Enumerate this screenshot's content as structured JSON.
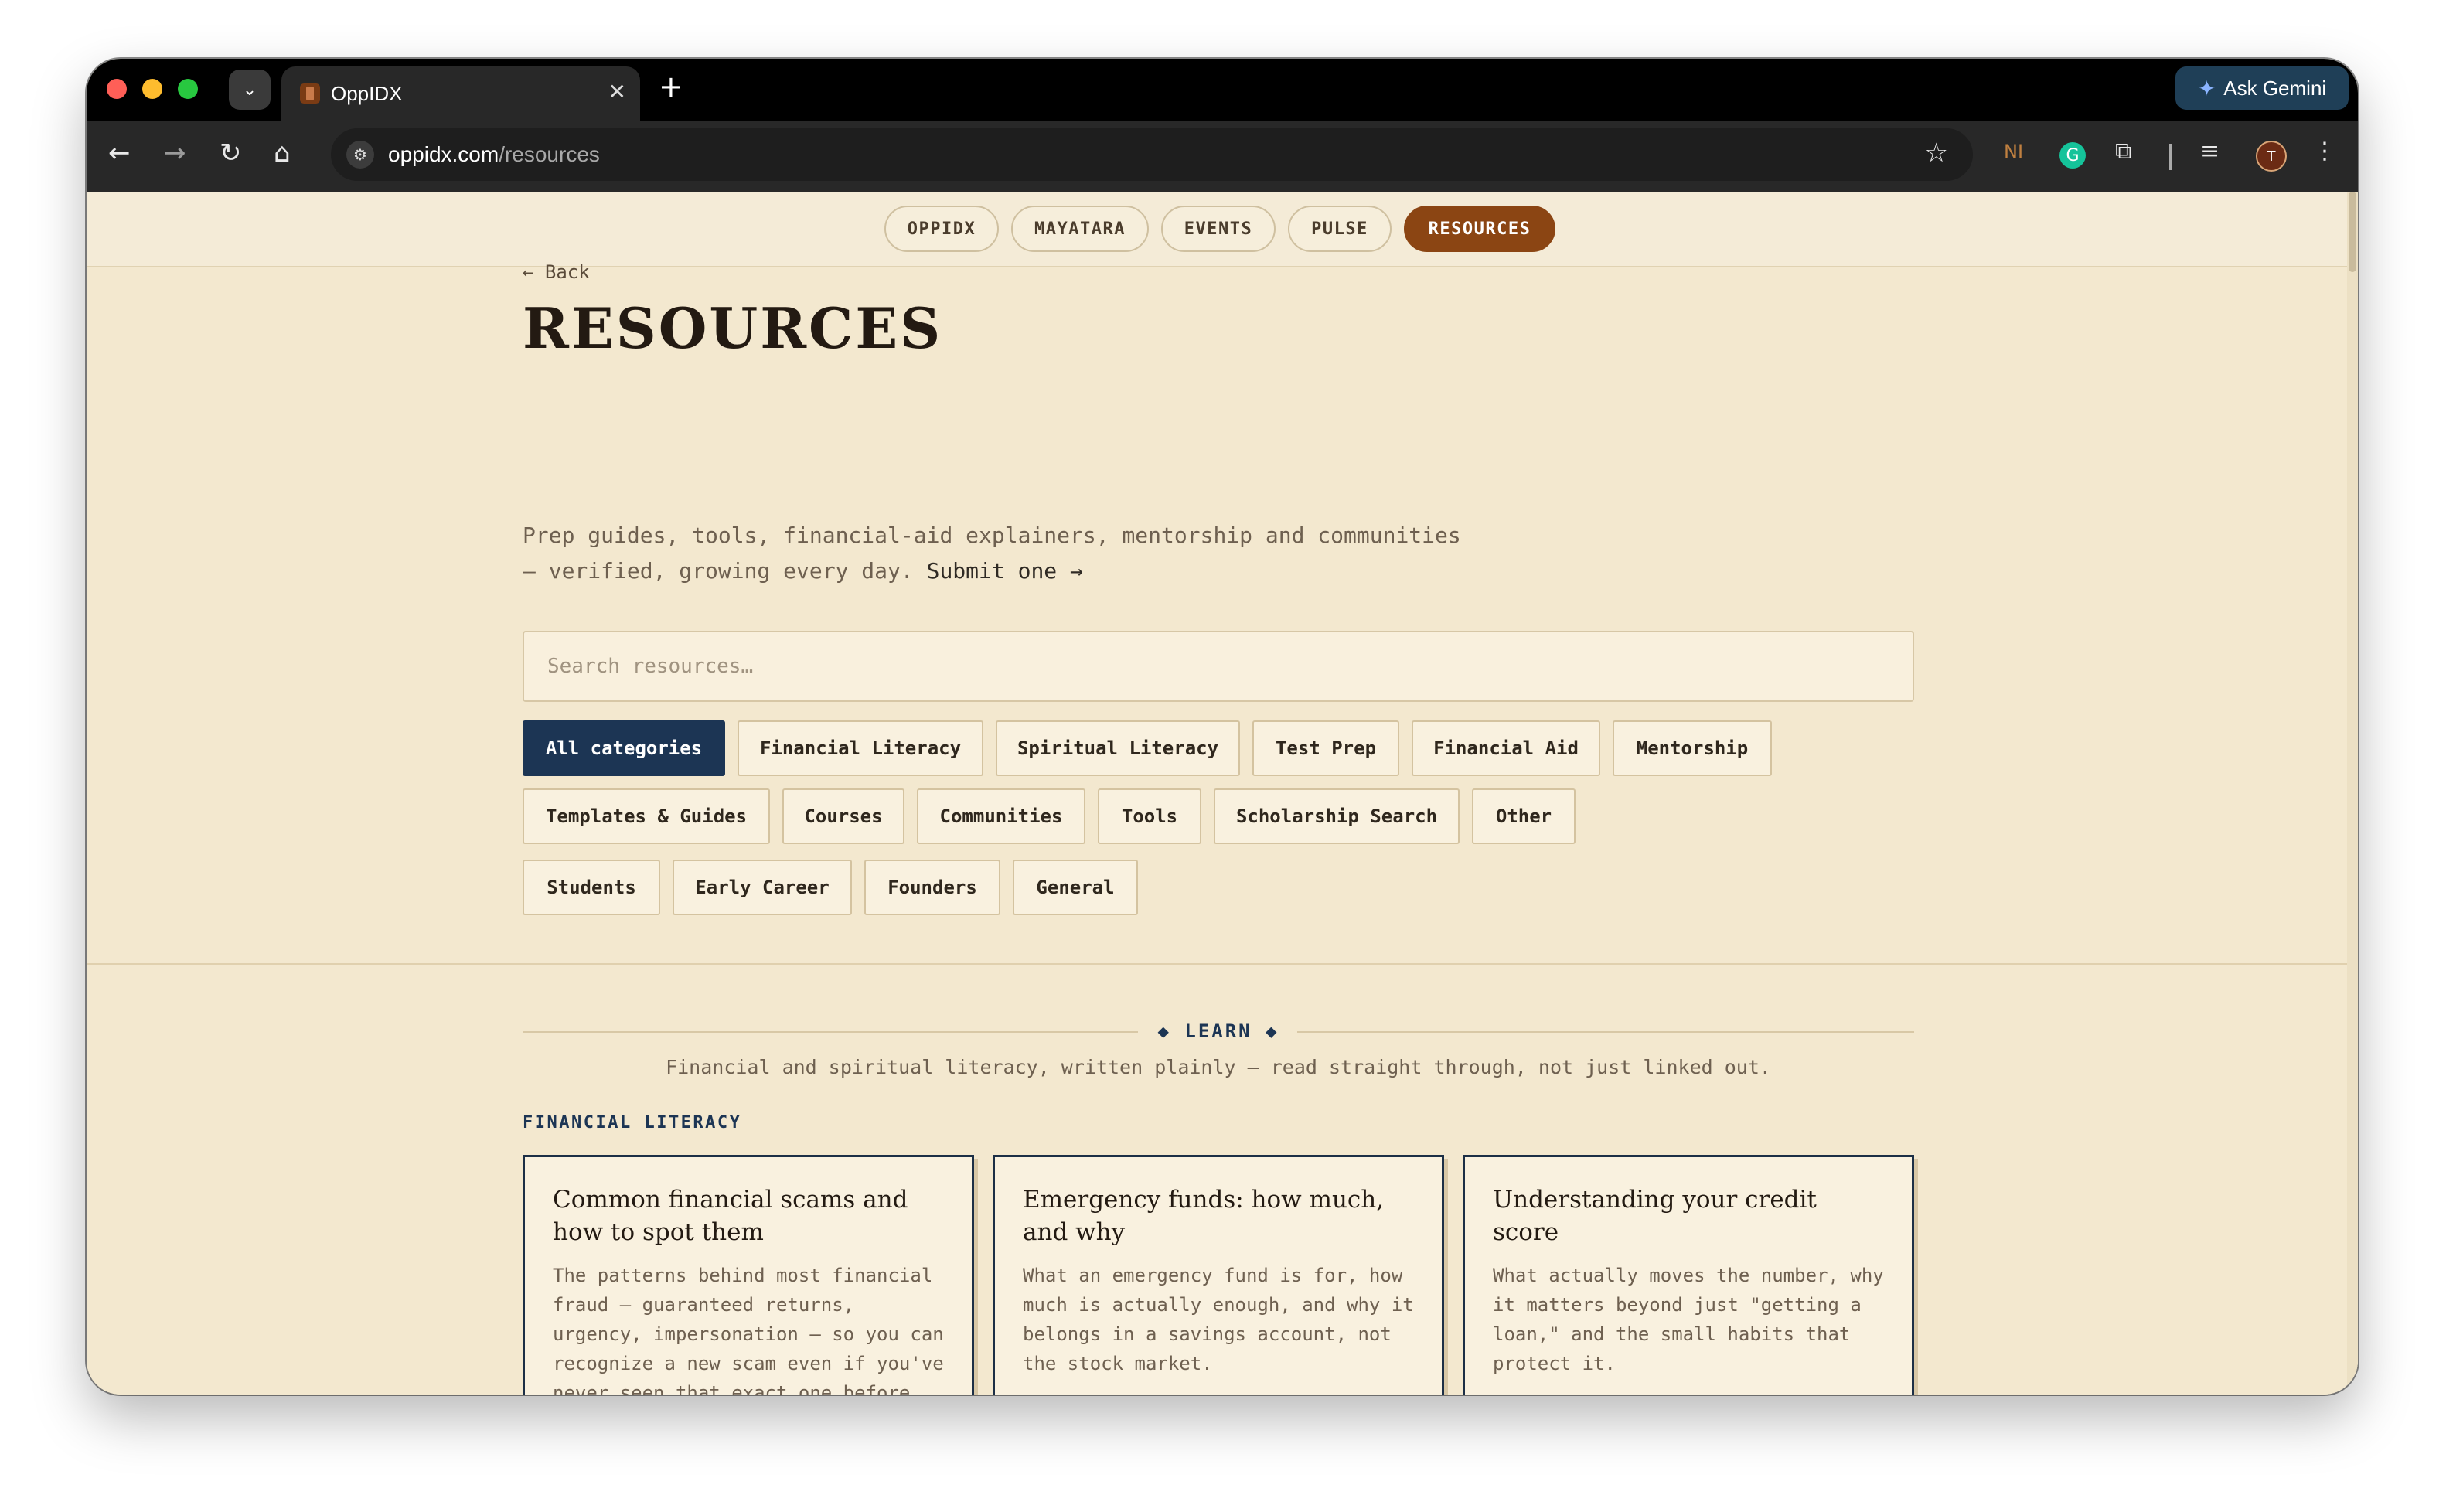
{
  "browser": {
    "tab_title": "OppIDX",
    "tab_close": "✕",
    "new_tab": "+",
    "tab_dropdown": "⌄",
    "ask_gemini": "Ask Gemini",
    "url_domain": "oppidx.com",
    "url_path": "/resources",
    "icons": [
      "back-icon",
      "forward-icon",
      "reload-icon",
      "home-icon",
      "site-info-icon",
      "bookmark-star-icon",
      "extension-ni-icon",
      "grammarly-icon",
      "extensions-puzzle-icon",
      "reading-list-icon",
      "profile-avatar-icon",
      "menu-kebab-icon"
    ],
    "avatar_letter": "T",
    "ni_label": "NI"
  },
  "topnav": {
    "items": [
      {
        "label": "OPPIDX",
        "active": false
      },
      {
        "label": "MAYATARA",
        "active": false
      },
      {
        "label": "EVENTS",
        "active": false
      },
      {
        "label": "PULSE",
        "active": false
      },
      {
        "label": "RESOURCES",
        "active": true
      }
    ]
  },
  "header": {
    "back": "← Back",
    "title": "RESOURCES",
    "lead_1": "Prep guides, tools, financial-aid explainers, mentorship and communities",
    "lead_2": "— verified, growing every day. ",
    "submit_link": "Submit one →"
  },
  "search": {
    "placeholder": "Search resources…",
    "value": ""
  },
  "categories": {
    "row1": [
      "All categories",
      "Financial Literacy",
      "Spiritual Literacy",
      "Test Prep",
      "Financial Aid",
      "Mentorship"
    ],
    "row2": [
      "Templates & Guides",
      "Courses",
      "Communities",
      "Tools",
      "Scholarship Search",
      "Other"
    ],
    "row3": [
      "Students",
      "Early Career",
      "Founders",
      "General"
    ],
    "selected": "All categories"
  },
  "learn": {
    "label": "◆ LEARN ◆",
    "description": "Financial and spiritual literacy, written plainly — read straight through, not just linked out.",
    "subhead": "FINANCIAL LITERACY",
    "cards": [
      {
        "title": "Common financial scams and how to spot them",
        "desc": "The patterns behind most financial fraud — guaranteed returns, urgency, impersonation — so you can recognize a new scam even if you've never seen that exact one before."
      },
      {
        "title": "Emergency funds: how much, and why",
        "desc": "What an emergency fund is for, how much is actually enough, and why it belongs in a savings account, not the stock market."
      },
      {
        "title": "Understanding your credit score",
        "desc": "What actually moves the number, why it matters beyond just \"getting a loan,\" and the small habits that protect it."
      }
    ]
  },
  "colors": {
    "page_bg": "#f3e8cf",
    "accent_nav": "#8b4513",
    "accent_chip": "#1c3554"
  }
}
